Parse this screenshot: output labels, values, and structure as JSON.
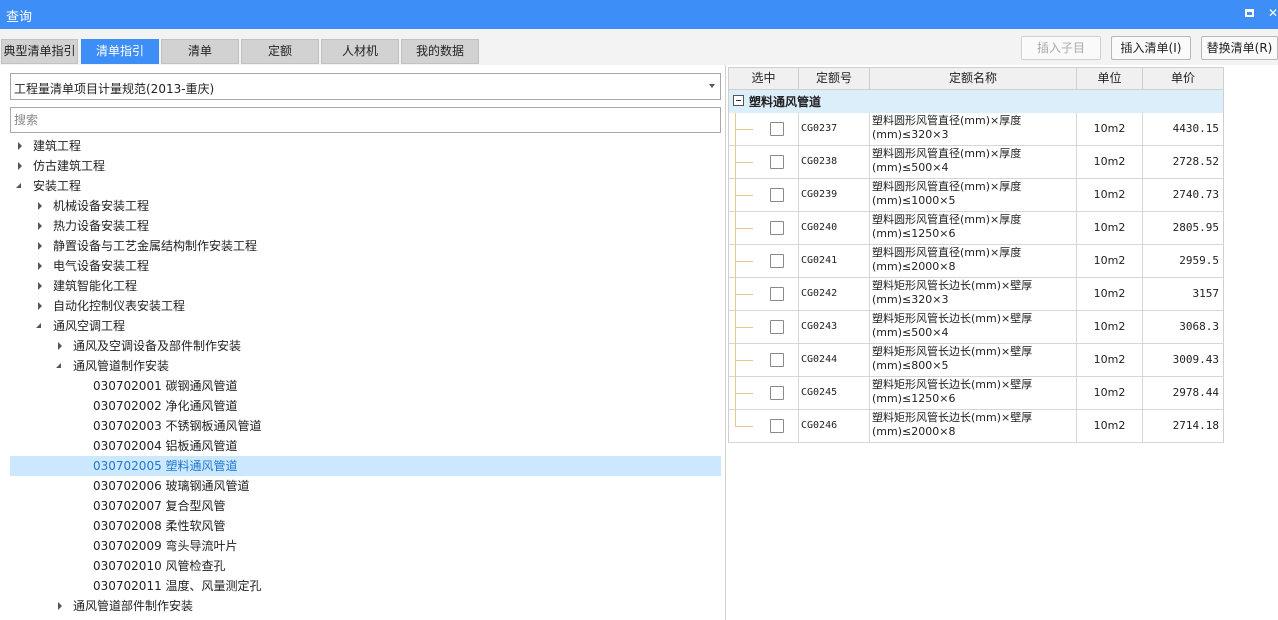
{
  "window": {
    "title": "查询"
  },
  "tabs": [
    {
      "label": "典型清单指引",
      "active": false
    },
    {
      "label": "清单指引",
      "active": true
    },
    {
      "label": "清单",
      "active": false
    },
    {
      "label": "定额",
      "active": false
    },
    {
      "label": "人材机",
      "active": false
    },
    {
      "label": "我的数据",
      "active": false
    }
  ],
  "toolbar": {
    "insert_child": "插入子目",
    "insert_list": "插入清单(I)",
    "replace_list": "替换清单(R)"
  },
  "left": {
    "spec_select": "工程量清单项目计量规范(2013-重庆)",
    "search_placeholder": "搜索",
    "tree": [
      {
        "label": "建筑工程",
        "level": 0,
        "state": "collapsed"
      },
      {
        "label": "仿古建筑工程",
        "level": 0,
        "state": "collapsed"
      },
      {
        "label": "安装工程",
        "level": 0,
        "state": "expanded"
      },
      {
        "label": "机械设备安装工程",
        "level": 1,
        "state": "collapsed"
      },
      {
        "label": "热力设备安装工程",
        "level": 1,
        "state": "collapsed"
      },
      {
        "label": "静置设备与工艺金属结构制作安装工程",
        "level": 1,
        "state": "collapsed"
      },
      {
        "label": "电气设备安装工程",
        "level": 1,
        "state": "collapsed"
      },
      {
        "label": "建筑智能化工程",
        "level": 1,
        "state": "collapsed"
      },
      {
        "label": "自动化控制仪表安装工程",
        "level": 1,
        "state": "collapsed"
      },
      {
        "label": "通风空调工程",
        "level": 1,
        "state": "expanded"
      },
      {
        "label": "通风及空调设备及部件制作安装",
        "level": 2,
        "state": "collapsed"
      },
      {
        "label": "通风管道制作安装",
        "level": 2,
        "state": "expanded"
      },
      {
        "label": "030702001  碳钢通风管道",
        "level": 3,
        "state": "leaf"
      },
      {
        "label": "030702002  净化通风管道",
        "level": 3,
        "state": "leaf"
      },
      {
        "label": "030702003  不锈钢板通风管道",
        "level": 3,
        "state": "leaf"
      },
      {
        "label": "030702004  铝板通风管道",
        "level": 3,
        "state": "leaf"
      },
      {
        "label": "030702005  塑料通风管道",
        "level": 3,
        "state": "leaf",
        "selected": true
      },
      {
        "label": "030702006  玻璃钢通风管道",
        "level": 3,
        "state": "leaf"
      },
      {
        "label": "030702007  复合型风管",
        "level": 3,
        "state": "leaf"
      },
      {
        "label": "030702008  柔性软风管",
        "level": 3,
        "state": "leaf"
      },
      {
        "label": "030702009  弯头导流叶片",
        "level": 3,
        "state": "leaf"
      },
      {
        "label": "030702010  风管检查孔",
        "level": 3,
        "state": "leaf"
      },
      {
        "label": "030702011  温度、风量测定孔",
        "level": 3,
        "state": "leaf"
      },
      {
        "label": "通风管道部件制作安装",
        "level": 2,
        "state": "collapsed"
      }
    ]
  },
  "grid": {
    "columns": [
      "选中",
      "定额号",
      "定额名称",
      "单位",
      "单价"
    ],
    "group_name": "塑料通风管道",
    "rows": [
      {
        "code": "CG0237",
        "name": "塑料圆形风管直径(mm)×厚度(mm)≤320×3",
        "unit": "10m2",
        "price": "4430.15"
      },
      {
        "code": "CG0238",
        "name": "塑料圆形风管直径(mm)×厚度(mm)≤500×4",
        "unit": "10m2",
        "price": "2728.52"
      },
      {
        "code": "CG0239",
        "name": "塑料圆形风管直径(mm)×厚度(mm)≤1000×5",
        "unit": "10m2",
        "price": "2740.73"
      },
      {
        "code": "CG0240",
        "name": "塑料圆形风管直径(mm)×厚度(mm)≤1250×6",
        "unit": "10m2",
        "price": "2805.95"
      },
      {
        "code": "CG0241",
        "name": "塑料圆形风管直径(mm)×厚度(mm)≤2000×8",
        "unit": "10m2",
        "price": "2959.5"
      },
      {
        "code": "CG0242",
        "name": "塑料矩形风管长边长(mm)×壁厚(mm)≤320×3",
        "unit": "10m2",
        "price": "3157"
      },
      {
        "code": "CG0243",
        "name": "塑料矩形风管长边长(mm)×壁厚(mm)≤500×4",
        "unit": "10m2",
        "price": "3068.3"
      },
      {
        "code": "CG0244",
        "name": "塑料矩形风管长边长(mm)×壁厚(mm)≤800×5",
        "unit": "10m2",
        "price": "3009.43"
      },
      {
        "code": "CG0245",
        "name": "塑料矩形风管长边长(mm)×壁厚(mm)≤1250×6",
        "unit": "10m2",
        "price": "2978.44"
      },
      {
        "code": "CG0246",
        "name": "塑料矩形风管长边长(mm)×壁厚(mm)≤2000×8",
        "unit": "10m2",
        "price": "2714.18"
      }
    ]
  },
  "colors": {
    "accent": "#3d8ef6",
    "selected_row": "#cce8ff",
    "group_bg": "#ddeefb"
  },
  "icons": {
    "maximize": "maximize-icon",
    "close": "close-icon",
    "tree_expander": "triangle-icon",
    "group_collapse": "minus-box-icon"
  }
}
